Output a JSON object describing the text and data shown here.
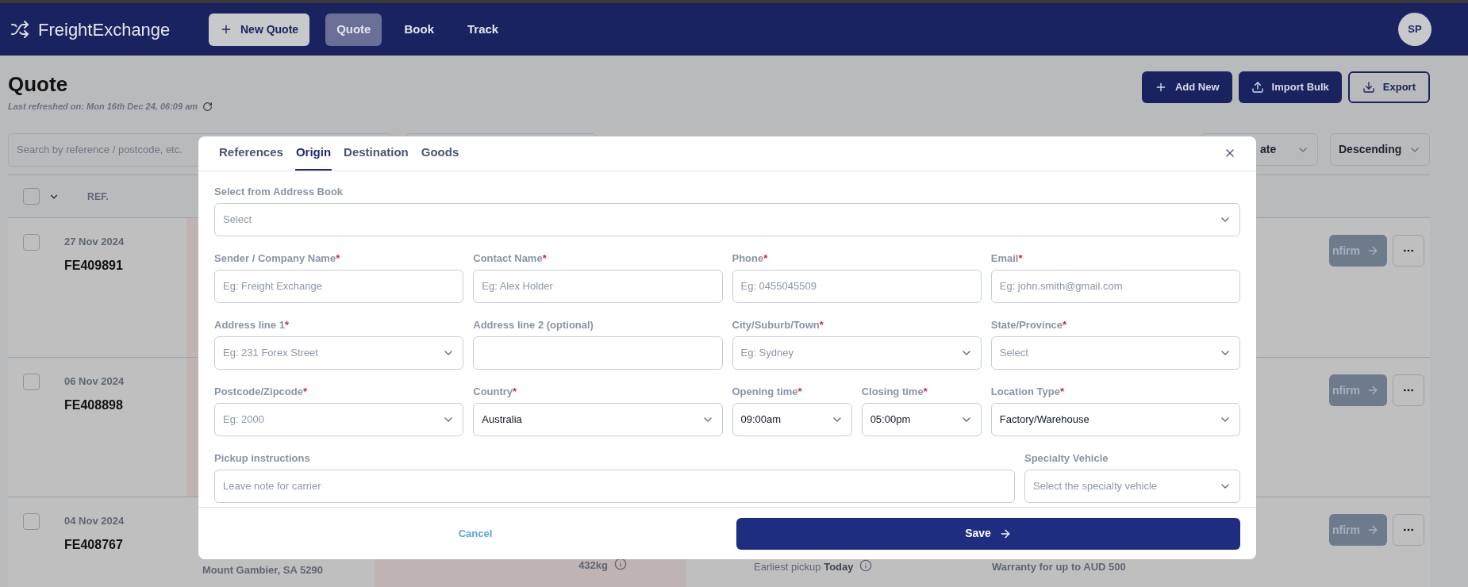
{
  "header": {
    "logo": "FreightExchange",
    "new_quote": "New Quote",
    "nav": [
      {
        "label": "Quote",
        "selected": true
      },
      {
        "label": "Book",
        "selected": false
      },
      {
        "label": "Track",
        "selected": false
      }
    ],
    "avatar": "SP"
  },
  "page": {
    "title": "Quote",
    "refreshed": "Last refreshed on: Mon 16th Dec 24, 06:09 am",
    "actions": [
      {
        "label": "Add New",
        "kind": "add"
      },
      {
        "label": "Import Bulk",
        "kind": "import"
      },
      {
        "label": "Export",
        "kind": "export"
      }
    ],
    "search": {
      "placeholder": "Search by reference / postcode, etc."
    },
    "sort_field": "ate",
    "sort_order": "Descending"
  },
  "table": {
    "columns": [
      "REF."
    ],
    "select_all_checked": false,
    "rows": [
      {
        "date": "27 Nov 2024",
        "ref": "FE409891",
        "checked": false,
        "flagged": true,
        "confirm": "nfirm"
      },
      {
        "date": "06 Nov 2024",
        "ref": "FE408898",
        "checked": false,
        "flagged": true,
        "confirm": "nfirm"
      },
      {
        "date": "04 Nov 2024",
        "ref": "FE408767",
        "checked": false,
        "flagged": false,
        "confirm": "nfirm",
        "origin": "Mount Gambier, SA 5290",
        "weight": "432kg",
        "pickup": "Earliest pickup **Today**",
        "warranty": "Warranty for up to AUD 500"
      }
    ]
  },
  "modal": {
    "tabs": [
      {
        "label": "References",
        "selected": false
      },
      {
        "label": "Origin",
        "selected": true
      },
      {
        "label": "Destination",
        "selected": false
      },
      {
        "label": "Goods",
        "selected": false
      }
    ],
    "address_book": {
      "label": "Select from Address Book",
      "placeholder": "Select"
    },
    "rows": [
      [
        {
          "label": "Sender / Company Name",
          "required": "*",
          "kind": "text",
          "placeholder": "Eg: Freight Exchange"
        },
        {
          "label": "Contact Name",
          "required": "*",
          "kind": "text",
          "placeholder": "Eg: Alex Holder"
        },
        {
          "label": "Phone",
          "required": "*",
          "kind": "text",
          "placeholder": "Eg: 0455045509"
        },
        {
          "label": "Email",
          "required": "*",
          "kind": "text",
          "placeholder": "Eg: john.smith@gmail.com"
        }
      ],
      [
        {
          "label": "Address line 1",
          "required": "*",
          "kind": "select",
          "placeholder": "Eg: 231 Forex Street"
        },
        {
          "label": "Address line 2 (optional)",
          "kind": "text"
        },
        {
          "label": "City/Suburb/Town",
          "required": "*",
          "kind": "select",
          "placeholder": "Eg: Sydney"
        },
        {
          "label": "State/Province",
          "required": "*",
          "kind": "select",
          "placeholder": "Select"
        }
      ],
      [
        {
          "label": "Postcode/Zipcode",
          "required": "*",
          "kind": "select",
          "placeholder": "Eg: 2000"
        },
        {
          "label": "Country",
          "required": "*",
          "kind": "select",
          "value": "Australia"
        },
        {
          "label": "Opening time",
          "required": "*",
          "kind": "select",
          "value": "09:00am"
        },
        {
          "label": "Closing time",
          "required": "*",
          "kind": "select",
          "value": "05:00pm"
        },
        {
          "label": "Location Type",
          "required": "*",
          "kind": "select",
          "value": "Factory/Warehouse"
        }
      ]
    ],
    "pickup_instructions": {
      "label": "Pickup instructions",
      "kind": "text",
      "placeholder": "Leave note for carrier"
    },
    "specialty_vehicle": {
      "label": "Specialty Vehicle",
      "kind": "select",
      "placeholder": "Select the specialty vehicle"
    },
    "cancel": "Cancel",
    "save": "Save"
  }
}
